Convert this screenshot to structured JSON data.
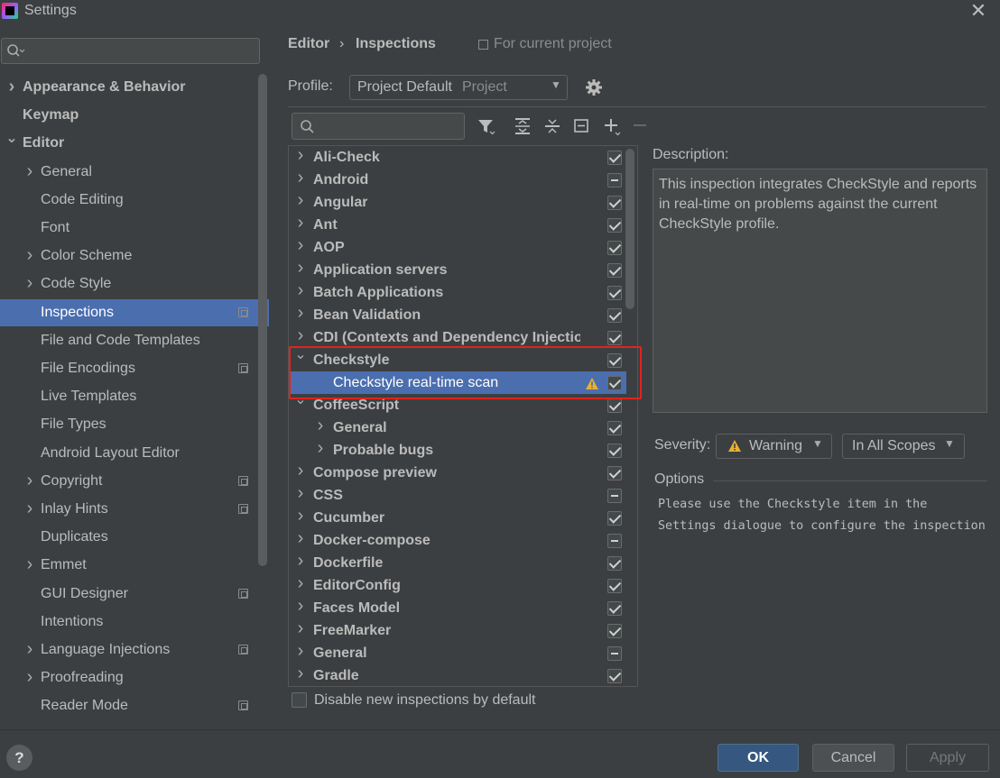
{
  "window": {
    "title": "Settings"
  },
  "sidebar": {
    "search_placeholder": "",
    "items": [
      {
        "label": "Appearance & Behavior",
        "bold": true,
        "chev": "right",
        "indent": 0,
        "proj": false
      },
      {
        "label": "Keymap",
        "bold": true,
        "chev": "",
        "indent": 0,
        "proj": false
      },
      {
        "label": "Editor",
        "bold": true,
        "chev": "down",
        "indent": 0,
        "proj": false
      },
      {
        "label": "General",
        "bold": false,
        "chev": "right",
        "indent": 1,
        "proj": false
      },
      {
        "label": "Code Editing",
        "bold": false,
        "chev": "",
        "indent": 1,
        "proj": false
      },
      {
        "label": "Font",
        "bold": false,
        "chev": "",
        "indent": 1,
        "proj": false
      },
      {
        "label": "Color Scheme",
        "bold": false,
        "chev": "right",
        "indent": 1,
        "proj": false
      },
      {
        "label": "Code Style",
        "bold": false,
        "chev": "right",
        "indent": 1,
        "proj": false
      },
      {
        "label": "Inspections",
        "bold": false,
        "chev": "",
        "indent": 1,
        "proj": true,
        "selected": true
      },
      {
        "label": "File and Code Templates",
        "bold": false,
        "chev": "",
        "indent": 1,
        "proj": false
      },
      {
        "label": "File Encodings",
        "bold": false,
        "chev": "",
        "indent": 1,
        "proj": true
      },
      {
        "label": "Live Templates",
        "bold": false,
        "chev": "",
        "indent": 1,
        "proj": false
      },
      {
        "label": "File Types",
        "bold": false,
        "chev": "",
        "indent": 1,
        "proj": false
      },
      {
        "label": "Android Layout Editor",
        "bold": false,
        "chev": "",
        "indent": 1,
        "proj": false
      },
      {
        "label": "Copyright",
        "bold": false,
        "chev": "right",
        "indent": 1,
        "proj": true
      },
      {
        "label": "Inlay Hints",
        "bold": false,
        "chev": "right",
        "indent": 1,
        "proj": true
      },
      {
        "label": "Duplicates",
        "bold": false,
        "chev": "",
        "indent": 1,
        "proj": false
      },
      {
        "label": "Emmet",
        "bold": false,
        "chev": "right",
        "indent": 1,
        "proj": false
      },
      {
        "label": "GUI Designer",
        "bold": false,
        "chev": "",
        "indent": 1,
        "proj": true
      },
      {
        "label": "Intentions",
        "bold": false,
        "chev": "",
        "indent": 1,
        "proj": false
      },
      {
        "label": "Language Injections",
        "bold": false,
        "chev": "right",
        "indent": 1,
        "proj": true
      },
      {
        "label": "Proofreading",
        "bold": false,
        "chev": "right",
        "indent": 1,
        "proj": false
      },
      {
        "label": "Reader Mode",
        "bold": false,
        "chev": "",
        "indent": 1,
        "proj": true
      }
    ]
  },
  "breadcrumb": {
    "editor": "Editor",
    "separator": "›",
    "inspections": "Inspections",
    "scope_note": "For current project"
  },
  "profile": {
    "label": "Profile:",
    "value": "Project Default",
    "scope": "Project"
  },
  "search": {
    "placeholder": ""
  },
  "inspections": [
    {
      "label": "Ali-Check",
      "bold": true,
      "chev": "right",
      "indent": 0,
      "state": "checked"
    },
    {
      "label": "Android",
      "bold": true,
      "chev": "right",
      "indent": 0,
      "state": "mixed"
    },
    {
      "label": "Angular",
      "bold": true,
      "chev": "right",
      "indent": 0,
      "state": "checked"
    },
    {
      "label": "Ant",
      "bold": true,
      "chev": "right",
      "indent": 0,
      "state": "checked"
    },
    {
      "label": "AOP",
      "bold": true,
      "chev": "right",
      "indent": 0,
      "state": "checked"
    },
    {
      "label": "Application servers",
      "bold": true,
      "chev": "right",
      "indent": 0,
      "state": "checked"
    },
    {
      "label": "Batch Applications",
      "bold": true,
      "chev": "right",
      "indent": 0,
      "state": "checked"
    },
    {
      "label": "Bean Validation",
      "bold": true,
      "chev": "right",
      "indent": 0,
      "state": "checked"
    },
    {
      "label": "CDI (Contexts and Dependency Injectio",
      "bold": true,
      "chev": "right",
      "indent": 0,
      "state": "checked"
    },
    {
      "label": "Checkstyle",
      "bold": true,
      "chev": "down",
      "indent": 0,
      "state": "checked"
    },
    {
      "label": "Checkstyle real-time scan",
      "bold": false,
      "chev": "",
      "indent": 1,
      "state": "checked",
      "warning": true,
      "selected": true
    },
    {
      "label": "CoffeeScript",
      "bold": true,
      "chev": "down",
      "indent": 0,
      "state": "checked"
    },
    {
      "label": "General",
      "bold": true,
      "chev": "right",
      "indent": 1,
      "state": "checked"
    },
    {
      "label": "Probable bugs",
      "bold": true,
      "chev": "right",
      "indent": 1,
      "state": "checked"
    },
    {
      "label": "Compose preview",
      "bold": true,
      "chev": "right",
      "indent": 0,
      "state": "checked"
    },
    {
      "label": "CSS",
      "bold": true,
      "chev": "right",
      "indent": 0,
      "state": "mixed"
    },
    {
      "label": "Cucumber",
      "bold": true,
      "chev": "right",
      "indent": 0,
      "state": "checked"
    },
    {
      "label": "Docker-compose",
      "bold": true,
      "chev": "right",
      "indent": 0,
      "state": "mixed"
    },
    {
      "label": "Dockerfile",
      "bold": true,
      "chev": "right",
      "indent": 0,
      "state": "checked"
    },
    {
      "label": "EditorConfig",
      "bold": true,
      "chev": "right",
      "indent": 0,
      "state": "checked"
    },
    {
      "label": "Faces Model",
      "bold": true,
      "chev": "right",
      "indent": 0,
      "state": "checked"
    },
    {
      "label": "FreeMarker",
      "bold": true,
      "chev": "right",
      "indent": 0,
      "state": "checked"
    },
    {
      "label": "General",
      "bold": true,
      "chev": "right",
      "indent": 0,
      "state": "mixed"
    },
    {
      "label": "Gradle",
      "bold": true,
      "chev": "right",
      "indent": 0,
      "state": "checked"
    }
  ],
  "disable_new": {
    "label": "Disable new inspections by default"
  },
  "description": {
    "label": "Description:",
    "text": "This inspection integrates CheckStyle and reports in real-time on problems against the current CheckStyle profile."
  },
  "severity": {
    "label": "Severity:",
    "value": "Warning",
    "scope": "In All Scopes"
  },
  "options": {
    "label": "Options",
    "text": "Please use the Checkstyle item in the\nSettings dialogue to configure the inspection"
  },
  "buttons": {
    "help": "?",
    "ok": "OK",
    "cancel": "Cancel",
    "apply": "Apply"
  },
  "colors": {
    "background": "#3c3f41",
    "selection": "#4b6eaf",
    "primary_button": "#365880",
    "highlight": "#e0241b",
    "warning": "#e8b030"
  },
  "icons": [
    "search-icon",
    "gear-icon",
    "filter-icon",
    "expand-all-icon",
    "collapse-all-icon",
    "reset-icon",
    "add-icon",
    "remove-icon",
    "warning-icon",
    "close-icon",
    "project-scope-icon"
  ]
}
